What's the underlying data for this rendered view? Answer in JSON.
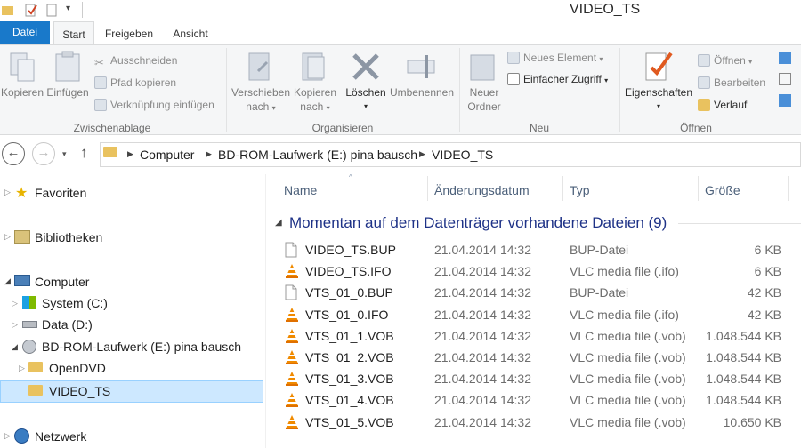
{
  "window": {
    "title": "VIDEO_TS"
  },
  "ribbon_tabs": [
    "Datei",
    "Start",
    "Freigeben",
    "Ansicht"
  ],
  "ribbon": {
    "clipboard": {
      "label": "Zwischenablage",
      "copy": "Kopieren",
      "paste": "Einfügen",
      "cut": "Ausschneiden",
      "copy_path": "Pfad kopieren",
      "paste_shortcut": "Verknüpfung einfügen"
    },
    "organize": {
      "label": "Organisieren",
      "move_to_1": "Verschieben",
      "move_to_2": "nach",
      "copy_to_1": "Kopieren",
      "copy_to_2": "nach",
      "delete": "Löschen",
      "rename": "Umbenennen"
    },
    "new": {
      "label": "Neu",
      "new_folder_1": "Neuer",
      "new_folder_2": "Ordner",
      "new_item": "Neues Element",
      "easy_access": "Einfacher Zugriff"
    },
    "open": {
      "label": "Öffnen",
      "properties": "Eigenschaften",
      "open": "Öffnen",
      "edit": "Bearbeiten",
      "history": "Verlauf"
    }
  },
  "address": {
    "crumbs": [
      "Computer",
      "BD-ROM-Laufwerk (E:) pina bausch",
      "VIDEO_TS"
    ]
  },
  "nav": {
    "favorites": "Favoriten",
    "libraries": "Bibliotheken",
    "computer": "Computer",
    "system": "System (C:)",
    "data": "Data (D:)",
    "bdrom": "BD-ROM-Laufwerk (E:) pina bausch",
    "opendvd": "OpenDVD",
    "videots": "VIDEO_TS",
    "network": "Netzwerk"
  },
  "columns": {
    "name": "Name",
    "date": "Änderungsdatum",
    "type": "Typ",
    "size": "Größe"
  },
  "group_header": "Momentan auf dem Datenträger vorhandene Dateien (9)",
  "files": [
    {
      "name": "VIDEO_TS.BUP",
      "date": "21.04.2014 14:32",
      "type": "BUP-Datei",
      "size": "6 KB",
      "icon": "file-icon"
    },
    {
      "name": "VIDEO_TS.IFO",
      "date": "21.04.2014 14:32",
      "type": "VLC media file (.ifo)",
      "size": "6 KB",
      "icon": "vlc-icon"
    },
    {
      "name": "VTS_01_0.BUP",
      "date": "21.04.2014 14:32",
      "type": "BUP-Datei",
      "size": "42 KB",
      "icon": "file-icon"
    },
    {
      "name": "VTS_01_0.IFO",
      "date": "21.04.2014 14:32",
      "type": "VLC media file (.ifo)",
      "size": "42 KB",
      "icon": "vlc-icon"
    },
    {
      "name": "VTS_01_1.VOB",
      "date": "21.04.2014 14:32",
      "type": "VLC media file (.vob)",
      "size": "1.048.544 KB",
      "icon": "vlc-icon"
    },
    {
      "name": "VTS_01_2.VOB",
      "date": "21.04.2014 14:32",
      "type": "VLC media file (.vob)",
      "size": "1.048.544 KB",
      "icon": "vlc-icon"
    },
    {
      "name": "VTS_01_3.VOB",
      "date": "21.04.2014 14:32",
      "type": "VLC media file (.vob)",
      "size": "1.048.544 KB",
      "icon": "vlc-icon"
    },
    {
      "name": "VTS_01_4.VOB",
      "date": "21.04.2014 14:32",
      "type": "VLC media file (.vob)",
      "size": "1.048.544 KB",
      "icon": "vlc-icon"
    },
    {
      "name": "VTS_01_5.VOB",
      "date": "21.04.2014 14:32",
      "type": "VLC media file (.vob)",
      "size": "10.650 KB",
      "icon": "vlc-icon"
    }
  ],
  "colors": {
    "accent": "#1979ca",
    "selection": "#cde8ff",
    "group_header": "#1e3287",
    "vlc_orange": "#f08a00"
  }
}
